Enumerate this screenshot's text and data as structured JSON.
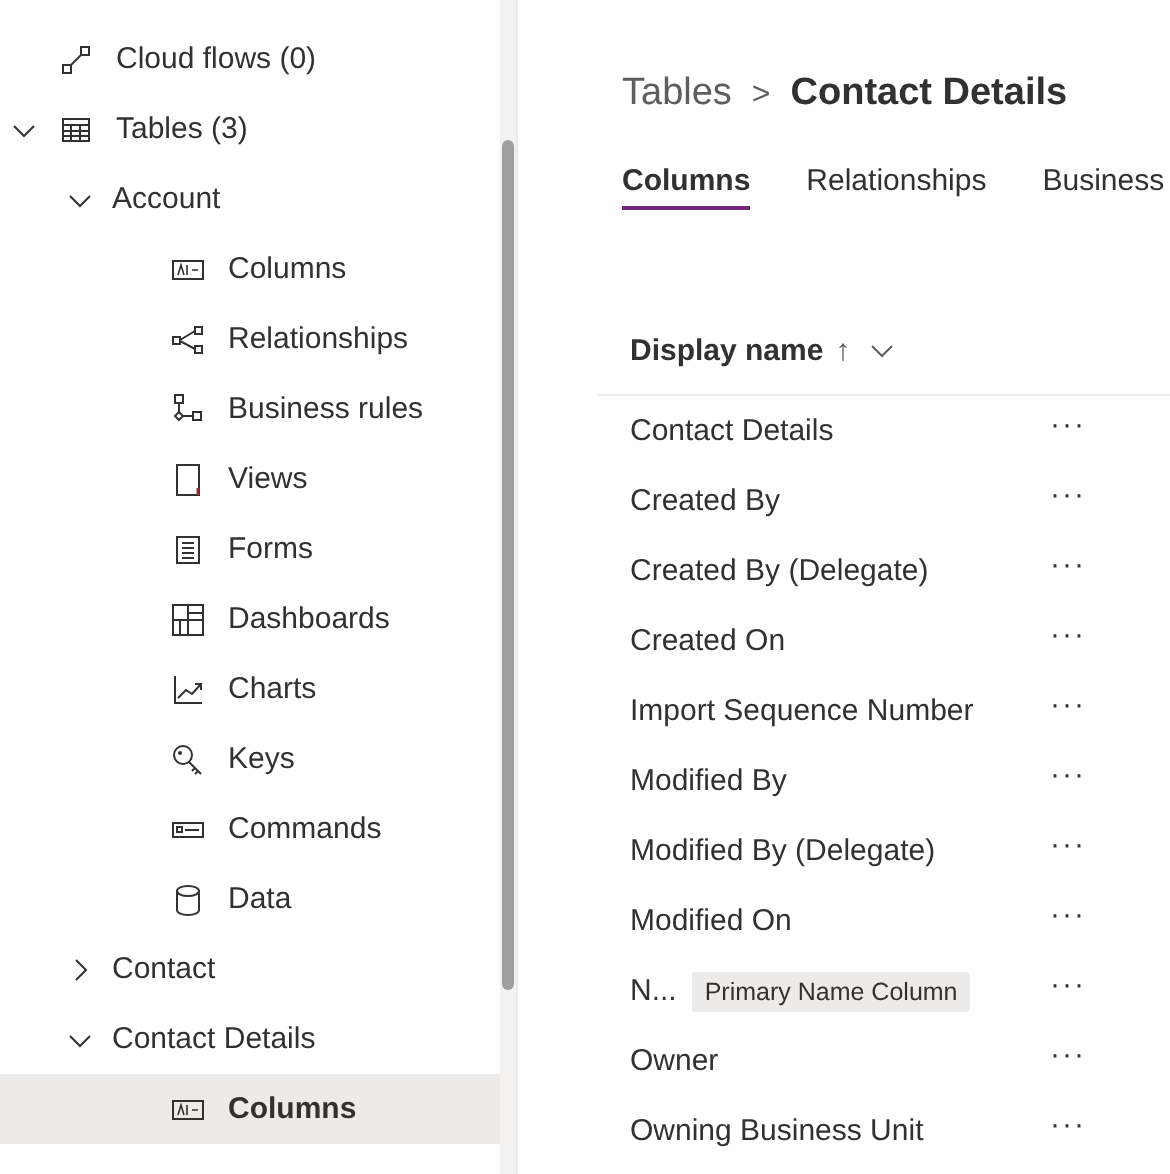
{
  "tree": [
    {
      "label": "Cloud flows (0)",
      "selected": false
    },
    {
      "label": "Tables (3)",
      "expanded": true,
      "children": [
        {
          "label": "Account",
          "expanded": true,
          "children": [
            {
              "label": "Columns",
              "selected": false
            },
            {
              "label": "Relationships",
              "selected": false
            },
            {
              "label": "Business rules",
              "selected": false
            },
            {
              "label": "Views",
              "selected": false
            },
            {
              "label": "Forms",
              "selected": false
            },
            {
              "label": "Dashboards",
              "selected": false
            },
            {
              "label": "Charts",
              "selected": false
            },
            {
              "label": "Keys",
              "selected": false
            },
            {
              "label": "Commands",
              "selected": false
            },
            {
              "label": "Data",
              "selected": false
            }
          ]
        },
        {
          "label": "Contact",
          "expanded": false
        },
        {
          "label": "Contact Details",
          "expanded": true,
          "children": [
            {
              "label": "Columns",
              "selected": true
            }
          ]
        }
      ]
    }
  ],
  "breadcrumb": {
    "parent": "Tables",
    "separator": ">",
    "current": "Contact Details"
  },
  "tabs": [
    {
      "label": "Columns",
      "selected": true
    },
    {
      "label": "Relationships",
      "selected": false
    },
    {
      "label": "Business",
      "selected": false
    }
  ],
  "table": {
    "column_header": "Display name",
    "sort_indicator": "↑",
    "rows": [
      {
        "name": "Contact Details",
        "menu": "···"
      },
      {
        "name": "Created By",
        "menu": "···"
      },
      {
        "name": "Created By (Delegate)",
        "menu": "···"
      },
      {
        "name": "Created On",
        "menu": "···"
      },
      {
        "name": "Import Sequence Number",
        "menu": "···"
      },
      {
        "name": "Modified By",
        "menu": "···"
      },
      {
        "name": "Modified By (Delegate)",
        "menu": "···"
      },
      {
        "name": "Modified On",
        "menu": "···"
      },
      {
        "name": "N...",
        "badge": "Primary Name Column",
        "menu": "···"
      },
      {
        "name": "Owner",
        "menu": "···"
      },
      {
        "name": "Owning Business Unit",
        "menu": "···"
      }
    ]
  }
}
